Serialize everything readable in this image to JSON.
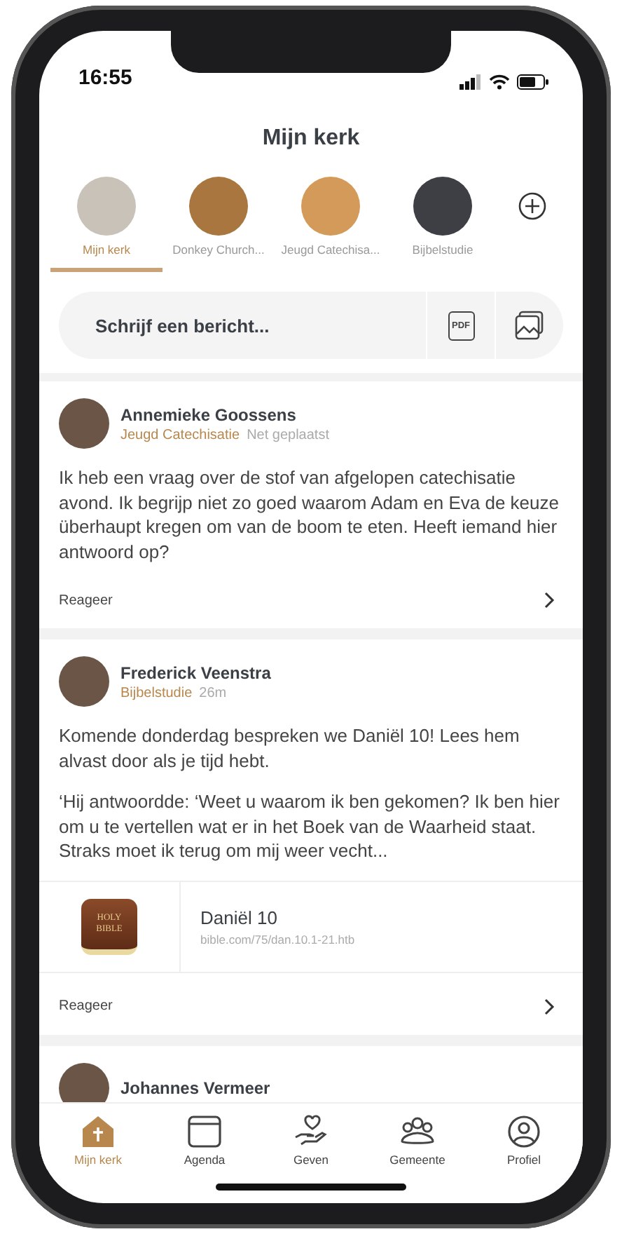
{
  "status_bar": {
    "time": "16:55"
  },
  "header": {
    "title": "Mijn kerk"
  },
  "groups": [
    {
      "label": "Mijn kerk",
      "selected": true,
      "color": "#c9c2b8"
    },
    {
      "label": "Donkey Church...",
      "selected": false,
      "color": "#a8763e"
    },
    {
      "label": "Jeugd Catechisa...",
      "selected": false,
      "color": "#d49a5a"
    },
    {
      "label": "Bijbelstudie",
      "selected": false,
      "color": "#3d3f44"
    }
  ],
  "composer": {
    "placeholder": "Schrijf een bericht...",
    "pdf_label": "PDF"
  },
  "posts": [
    {
      "author": "Annemieke Goossens",
      "group": "Jeugd Catechisatie",
      "time": "Net geplaatst",
      "paragraphs": [
        "Ik heb een vraag over de stof van afgelopen catechisatie avond. Ik begrijp niet zo goed waarom Adam en Eva de keuze überhaupt kregen om van de boom te eten. Heeft iemand hier antwoord op?"
      ],
      "reply": "Reageer"
    },
    {
      "author": "Frederick Veenstra",
      "group": "Bijbelstudie",
      "time": "26m",
      "paragraphs": [
        "Komende donderdag bespreken we Daniël 10! Lees hem alvast door als je tijd hebt.",
        "‘Hij antwoordde: ‘Weet u waarom ik ben gekomen? Ik ben hier om u te vertellen wat er in het Boek van de Waarheid staat. Straks moet ik terug om mij weer vecht..."
      ],
      "link": {
        "thumbnail_text": [
          "HOLY",
          "BIBLE"
        ],
        "title": "Daniël 10",
        "url": "bible.com/75/dan.10.1-21.htb"
      },
      "reply": "Reageer"
    },
    {
      "author": "Johannes Vermeer"
    }
  ],
  "tab_bar": [
    {
      "label": "Mijn kerk",
      "kind": "church",
      "selected": true
    },
    {
      "label": "Agenda",
      "kind": "calendar",
      "selected": false
    },
    {
      "label": "Geven",
      "kind": "give",
      "selected": false
    },
    {
      "label": "Gemeente",
      "kind": "people",
      "selected": false
    },
    {
      "label": "Profiel",
      "kind": "profile",
      "selected": false
    }
  ]
}
